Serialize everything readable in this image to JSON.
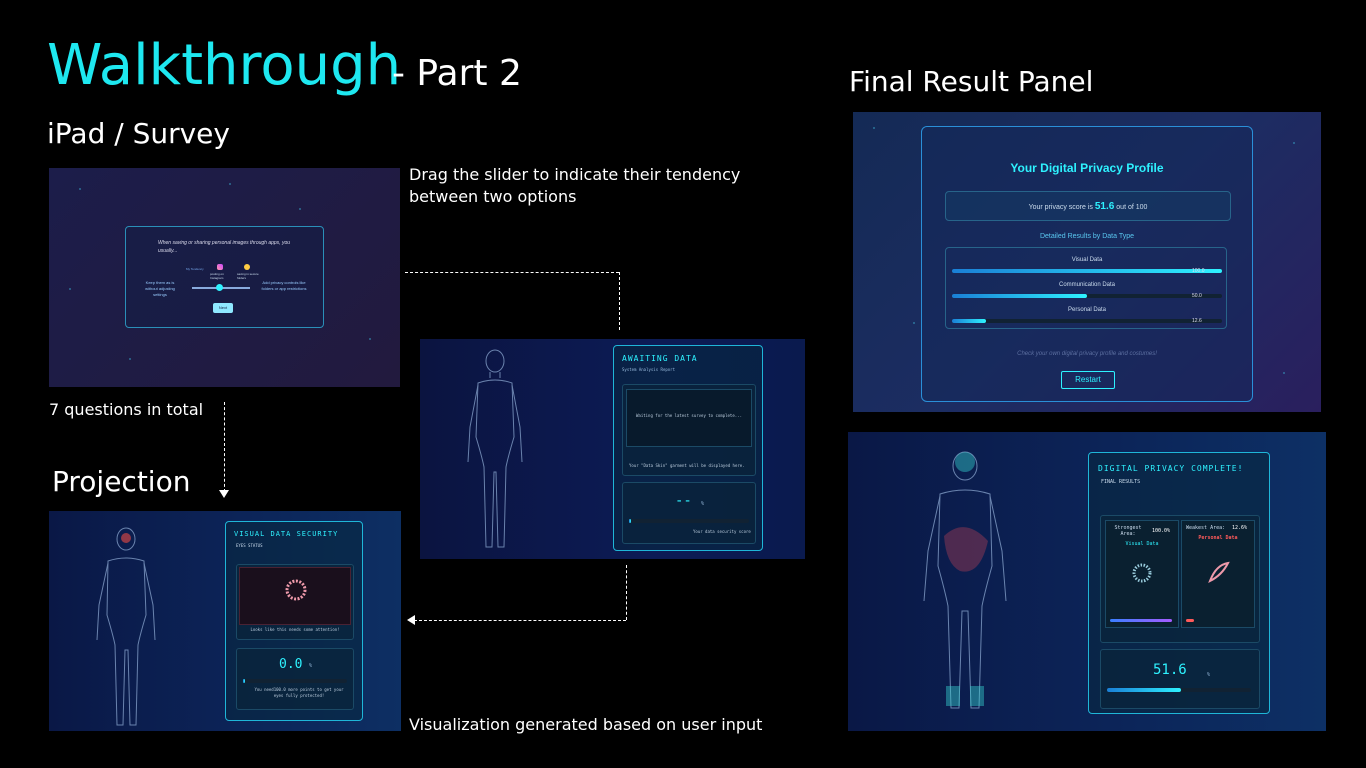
{
  "header": {
    "title": "Walkthrough",
    "subtitle": "- Part 2"
  },
  "sections": {
    "ipad": "iPad / Survey",
    "projection": "Projection",
    "final_result": "Final Result Panel"
  },
  "notes": {
    "slider": "Drag the slider to indicate their tendency between two options",
    "questions": "7 questions in total",
    "visualization": "Visualization generated based on user input"
  },
  "survey": {
    "question": "When saving or sharing personal images through apps, you usually...",
    "left_option": "Keep them as is without adjusting settings",
    "right_option": "Add privacy controls like folders or app restrictions",
    "icon_left_label": "posting on Instagram",
    "icon_right_label": "saving in secure folders",
    "tag": "My Tendency",
    "next_label": "Next"
  },
  "awaiting": {
    "title": "AWAITING DATA",
    "subtitle": "System Analysis Report",
    "waiting": "Waiting for the latest survey to complete...",
    "garment": "Your \"Data Skin\" garment will be displayed here.",
    "score": "--",
    "unit": "%",
    "score_label": "Your data security score"
  },
  "visual_security": {
    "title": "VISUAL DATA SECURITY",
    "subtitle": "EYES STATUS",
    "message": "Looks like this needs some attention!",
    "score": "0.0",
    "unit": "%",
    "score_note": "You need100.0 more points to get your eyes fully protected!",
    "progress": 0
  },
  "profile": {
    "title": "Your Digital Privacy Profile",
    "score_prefix": "Your privacy score is",
    "score": "51.6",
    "score_suffix": "out of 100",
    "details_title": "Detailed Results by Data Type",
    "items": [
      {
        "label": "Visual Data",
        "value": "100.0",
        "fill": 1.0
      },
      {
        "label": "Communication Data",
        "value": "50.0",
        "fill": 0.5
      },
      {
        "label": "Personal Data",
        "value": "12.6",
        "fill": 0.126
      }
    ],
    "footer": "Check your own digital privacy profile and costumes!",
    "restart_label": "Restart"
  },
  "complete": {
    "title": "DIGITAL PRIVACY COMPLETE!",
    "subtitle": "FINAL RESULTS",
    "strongest_label": "Strongest Area:",
    "strongest_value": "100.0%",
    "strongest_type": "Visual Data",
    "weakest_label": "Weakest Area:",
    "weakest_value": "12.6%",
    "weakest_type": "Personal Data",
    "score": "51.6",
    "unit": "%",
    "progress": 0.516
  },
  "colors": {
    "accent": "#1ee8f0",
    "danger": "#ff5a5a",
    "panel_border": "#1fb6d8"
  }
}
